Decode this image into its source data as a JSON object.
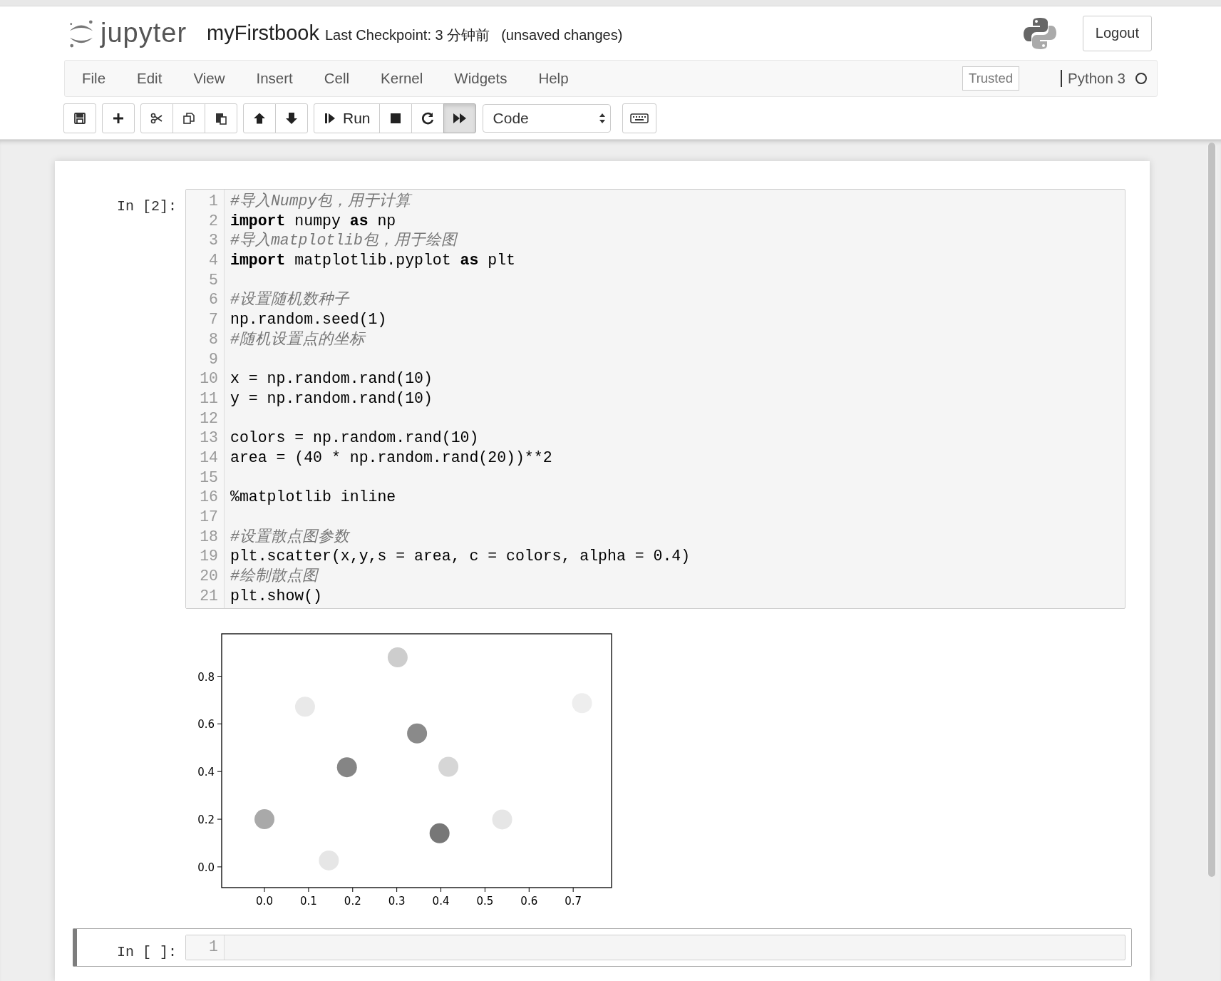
{
  "header": {
    "logo_text": "jupyter",
    "notebook_name": "myFirstbook",
    "checkpoint": "Last Checkpoint: 3 分钟前",
    "unsaved": "(unsaved changes)",
    "logout": "Logout"
  },
  "menu": {
    "items": [
      "File",
      "Edit",
      "View",
      "Insert",
      "Cell",
      "Kernel",
      "Widgets",
      "Help"
    ],
    "trusted": "Trusted",
    "kernel": "Python 3",
    "kernel_busy": false
  },
  "toolbar": {
    "groups": [
      [
        {
          "pressed": false
        }
      ],
      [
        {
          "pressed": false
        }
      ],
      [
        {
          "pressed": false
        },
        {
          "pressed": false
        },
        {
          "pressed": false
        }
      ],
      [
        {
          "pressed": false
        },
        {
          "pressed": false
        }
      ],
      [
        {
          "label": "Run",
          "pressed": false
        },
        {
          "pressed": false
        },
        {
          "pressed": false
        },
        {
          "pressed": true
        }
      ]
    ],
    "cell_type": "Code"
  },
  "cells": [
    {
      "prompt": "In [2]:",
      "selected": false,
      "lines": [
        {
          "number": "1",
          "kind": "comment",
          "text": "#导入Numpy包，用于计算"
        },
        {
          "number": "2",
          "kind": "code",
          "text": "**import** numpy **as** np"
        },
        {
          "number": "3",
          "kind": "comment",
          "text": "#导入matplotlib包，用于绘图"
        },
        {
          "number": "4",
          "kind": "code",
          "text": "**import** matplotlib.pyplot **as** plt"
        },
        {
          "number": "5"
        },
        {
          "number": "6",
          "kind": "comment",
          "text": "#设置随机数种子"
        },
        {
          "number": "7",
          "kind": "code",
          "text": "np.random.seed(1)"
        },
        {
          "number": "8",
          "kind": "comment",
          "text": "#随机设置点的坐标"
        },
        {
          "number": "9"
        },
        {
          "number": "10",
          "kind": "code",
          "text": "x = np.random.rand(10)"
        },
        {
          "number": "11",
          "kind": "code",
          "text": "y = np.random.rand(10)"
        },
        {
          "number": "12"
        },
        {
          "number": "13",
          "kind": "code",
          "text": "colors = np.random.rand(10)"
        },
        {
          "number": "14",
          "kind": "code",
          "text": "area = (40 * np.random.rand(20))**2"
        },
        {
          "number": "15"
        },
        {
          "number": "16",
          "kind": "code",
          "text": "%matplotlib inline"
        },
        {
          "number": "17"
        },
        {
          "number": "18",
          "kind": "comment",
          "text": "#设置散点图参数"
        },
        {
          "number": "19",
          "kind": "code",
          "text": "plt.scatter(x,y,s = area, c = colors, alpha = 0.4)"
        },
        {
          "number": "20",
          "kind": "comment",
          "text": "#绘制散点图"
        },
        {
          "number": "21",
          "kind": "code",
          "text": "plt.show()"
        }
      ],
      "output": {
        "chart_data": {
          "type": "scatter",
          "x": [
            0.0,
            0.146,
            0.092,
            0.187,
            0.302,
            0.346,
            0.417,
            0.397,
            0.539,
            0.72
          ],
          "series": [
            {
              "values": [
                0.2,
                0.027,
                0.672,
                0.418,
                0.879,
                0.56,
                0.42,
                0.141,
                0.199,
                0.687
              ],
              "colors": [
                "#a9a9a9",
                "#e6e6e6",
                "#e9e9e9",
                "#858585",
                "#cdcdcd",
                "#8a8a8a",
                "#d6d6d6",
                "#777777",
                "#e6e6e6",
                "#eeeeee"
              ]
            }
          ],
          "xlim": [
            -0.097,
            0.787
          ],
          "ylim": [
            -0.087,
            0.978
          ],
          "xticks": [
            {
              "value": 0,
              "label": "0.0"
            },
            {
              "value": 0.1,
              "label": "0.1"
            },
            {
              "value": 0.2,
              "label": "0.2"
            },
            {
              "value": 0.3,
              "label": "0.3"
            },
            {
              "value": 0.4,
              "label": "0.4"
            },
            {
              "value": 0.5,
              "label": "0.5"
            },
            {
              "value": 0.6,
              "label": "0.6"
            },
            {
              "value": 0.7,
              "label": "0.7"
            }
          ],
          "yticks": [
            {
              "value": 0,
              "label": "0.0"
            },
            {
              "value": 0.2,
              "label": "0.2"
            },
            {
              "value": 0.4,
              "label": "0.4"
            },
            {
              "value": 0.6,
              "label": "0.6"
            },
            {
              "value": 0.8,
              "label": "0.8"
            }
          ]
        }
      }
    },
    {
      "prompt": "In [ ]:",
      "selected": true,
      "lines": [
        {
          "number": "1"
        }
      ]
    }
  ]
}
